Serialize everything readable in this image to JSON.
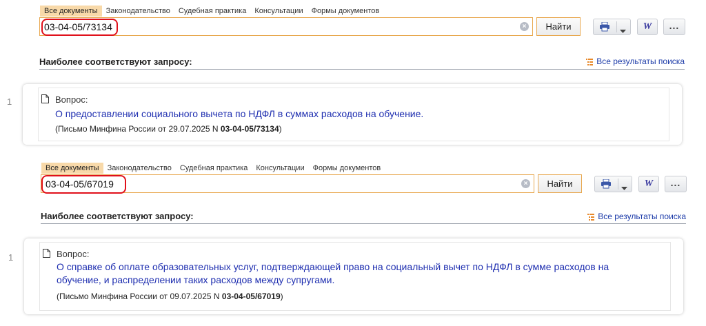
{
  "panels": [
    {
      "tabs": [
        "Все документы",
        "Законодательство",
        "Судебная практика",
        "Консультации",
        "Формы документов"
      ],
      "search_value": "03-04-05/73134",
      "find_label": "Найти",
      "section_title": "Наиболее соответствуют запросу:",
      "all_results_label": "Все результаты поиска",
      "result": {
        "index": "1",
        "label": "Вопрос:",
        "title": "О предоставлении социального вычета по НДФЛ в суммах расходов на обучение.",
        "source_prefix": "(Письмо Минфина России от 29.07.2025 N ",
        "source_number": "03-04-05/73134",
        "source_suffix": ")"
      }
    },
    {
      "tabs": [
        "Все документы",
        "Законодательство",
        "Судебная практика",
        "Консультации",
        "Формы документов"
      ],
      "search_value": "03-04-05/67019",
      "find_label": "Найти",
      "section_title": "Наиболее соответствуют запросу:",
      "all_results_label": "Все результаты поиска",
      "result": {
        "index": "1",
        "label": "Вопрос:",
        "title": "О справке об оплате образовательных услуг, подтверждающей право на социальный вычет по НДФЛ в сумме расходов на обучение, и распределении таких расходов между супругами.",
        "source_prefix": "(Письмо Минфина России от 09.07.2025 N ",
        "source_number": "03-04-05/67019",
        "source_suffix": ")"
      }
    }
  ],
  "icons": {
    "clear": "clear-icon",
    "print": "printer-icon",
    "dropdown": "chevron-down-icon",
    "word": "word-export-icon",
    "more": "more-icon",
    "results_list": "list-icon",
    "document": "document-icon"
  },
  "colors": {
    "accent_border": "#e8a84f",
    "active_tab": "#f8d9a9",
    "link": "#1f2fb0",
    "highlight": "#e0101a"
  }
}
